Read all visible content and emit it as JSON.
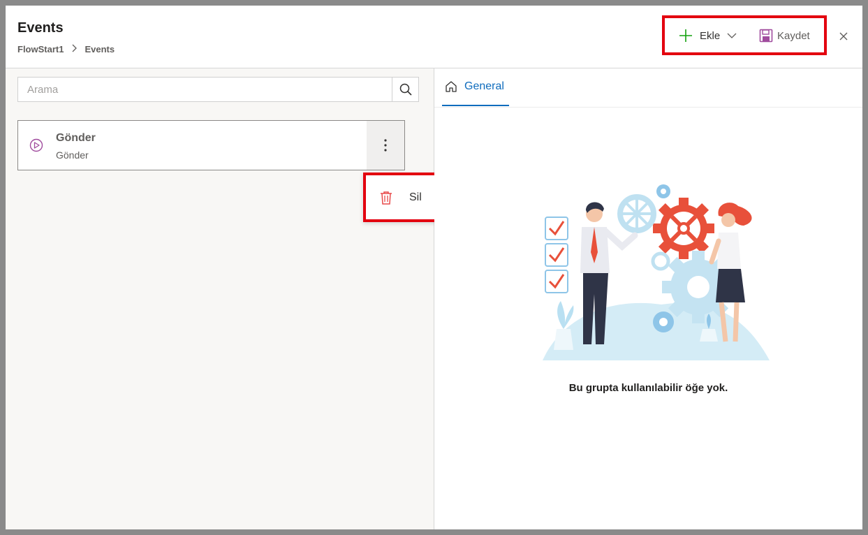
{
  "window": {
    "title": "Events",
    "breadcrumb": [
      "FlowStart1",
      "Events"
    ]
  },
  "toolbar": {
    "add_label": "Ekle",
    "save_label": "Kaydet",
    "icons": {
      "add": "plus-icon",
      "add_menu": "chevron-down-icon",
      "save": "save-icon",
      "close": "close-icon"
    },
    "colors": {
      "add_icon": "#13a10e",
      "save_icon": "#a04c9e",
      "highlight": "#e3000f"
    }
  },
  "search": {
    "placeholder": "Arama",
    "value": "",
    "icon": "search-icon"
  },
  "events": [
    {
      "name": "Gönder",
      "subtitle": "Gönder",
      "icon": "play-circle-icon"
    }
  ],
  "context_menu": {
    "items": [
      {
        "label": "Sil",
        "icon": "trash-icon",
        "color": "#e84a4a"
      }
    ]
  },
  "tabs": [
    {
      "label": "General",
      "icon": "home-icon",
      "selected": true
    }
  ],
  "empty_state": {
    "message": "Bu grupta kullanılabilir öğe yok."
  },
  "colors": {
    "accent": "#0f6cbd",
    "pane_bg": "#f8f7f5"
  }
}
